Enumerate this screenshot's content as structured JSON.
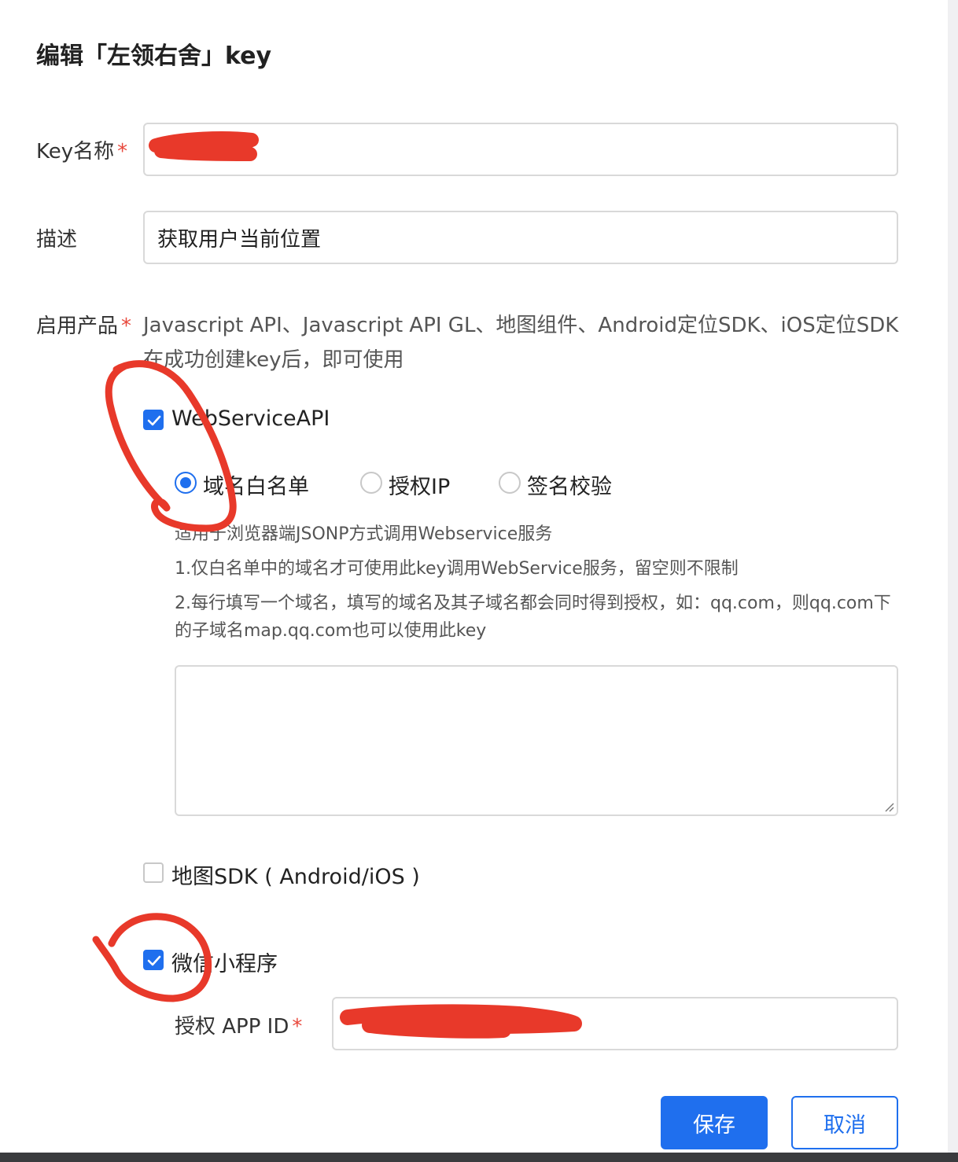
{
  "dialog": {
    "title": "编辑「左领右舍」key"
  },
  "form": {
    "key_name": {
      "label": "Key名称",
      "required_mark": "*",
      "value": ""
    },
    "description": {
      "label": "描述",
      "value": "获取用户当前位置"
    },
    "products": {
      "label": "启用产品",
      "required_mark": "*",
      "note": "Javascript API、Javascript API GL、地图组件、Android定位SDK、iOS定位SDK在成功创建key后，即可使用",
      "webservice": {
        "label": "WebServiceAPI",
        "checked": true,
        "modes": [
          {
            "label": "域名白名单",
            "selected": true
          },
          {
            "label": "授权IP",
            "selected": false
          },
          {
            "label": "签名校验",
            "selected": false
          }
        ],
        "help": [
          "适用于浏览器端JSONP方式调用Webservice服务",
          "1.仅白名单中的域名才可使用此key调用WebService服务，留空则不限制",
          "2.每行填写一个域名，填写的域名及其子域名都会同时得到授权，如：qq.com，则qq.com下的子域名map.qq.com也可以使用此key"
        ],
        "whitelist_value": ""
      },
      "map_sdk": {
        "label": "地图SDK ( Android/iOS )",
        "checked": false
      },
      "miniprogram": {
        "label": "微信小程序",
        "checked": true,
        "appid": {
          "label": "授权 APP ID",
          "required_mark": "*",
          "value": ""
        }
      }
    }
  },
  "actions": {
    "save_label": "保存",
    "cancel_label": "取消"
  },
  "colors": {
    "primary": "#1f6fee",
    "required": "#e8483c",
    "annotation": "#e8392a"
  }
}
